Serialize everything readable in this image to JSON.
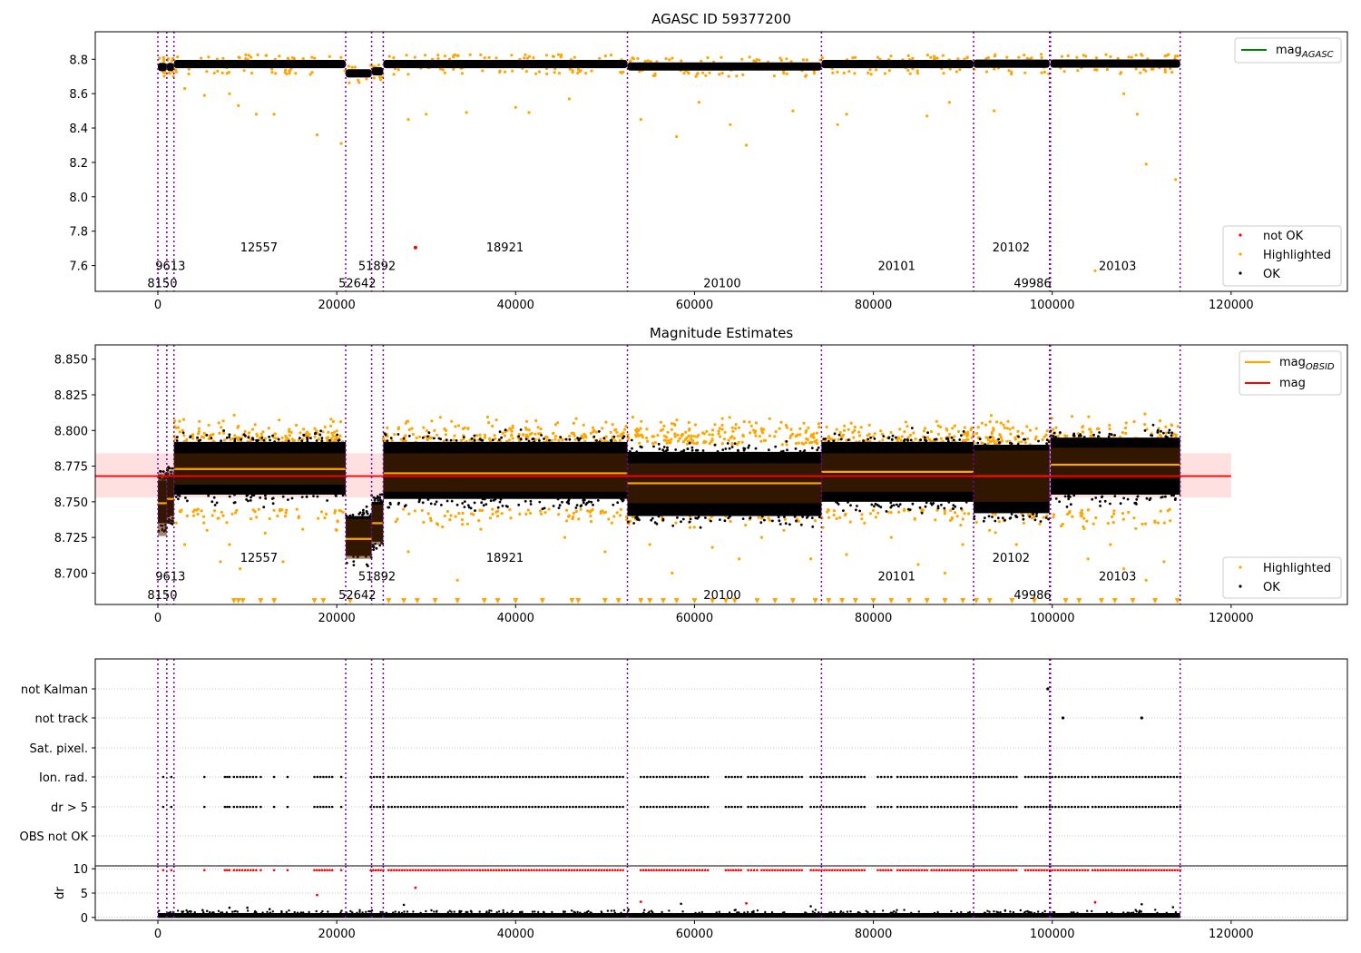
{
  "chart_data": [
    {
      "type": "scatter",
      "title": "AGASC ID 59377200",
      "xlabel": "",
      "ylabel": "",
      "xlim": [
        -7000,
        133000
      ],
      "ylim": [
        7.45,
        8.96
      ],
      "xticks": [
        0,
        20000,
        40000,
        60000,
        80000,
        100000,
        120000
      ],
      "xtick_labels": [
        "0",
        "20000",
        "40000",
        "60000",
        "80000",
        "100000",
        "120000"
      ],
      "yticks": [
        7.6,
        7.8,
        8.0,
        8.2,
        8.4,
        8.6,
        8.8
      ],
      "ytick_labels": [
        "7.6",
        "7.8",
        "8.0",
        "8.2",
        "8.4",
        "8.6",
        "8.8"
      ],
      "obsid_boundaries": [
        0,
        1000,
        1800,
        21000,
        23900,
        25200,
        52500,
        74200,
        91200,
        99700,
        99800,
        114300
      ],
      "obsid_labels": [
        {
          "text": "8150",
          "x": 500,
          "y": 7.5
        },
        {
          "text": "9613",
          "x": 1400,
          "y": 7.6
        },
        {
          "text": "12557",
          "x": 11300,
          "y": 7.71
        },
        {
          "text": "52642",
          "x": 22300,
          "y": 7.5
        },
        {
          "text": "51892",
          "x": 24500,
          "y": 7.6
        },
        {
          "text": "18921",
          "x": 38800,
          "y": 7.71
        },
        {
          "text": "20100",
          "x": 63100,
          "y": 7.5
        },
        {
          "text": "20101",
          "x": 82600,
          "y": 7.6
        },
        {
          "text": "20102",
          "x": 95400,
          "y": 7.71
        },
        {
          "text": "49986",
          "x": 97800,
          "y": 7.5
        },
        {
          "text": "20103",
          "x": 107300,
          "y": 7.6
        }
      ],
      "segments": [
        {
          "x0": 0,
          "x1": 1000,
          "mag": 8.755
        },
        {
          "x0": 1000,
          "x1": 1800,
          "mag": 8.755
        },
        {
          "x0": 1800,
          "x1": 21000,
          "mag": 8.772
        },
        {
          "x0": 21000,
          "x1": 23900,
          "mag": 8.718
        },
        {
          "x0": 23900,
          "x1": 25200,
          "mag": 8.73
        },
        {
          "x0": 25200,
          "x1": 52500,
          "mag": 8.772
        },
        {
          "x0": 52500,
          "x1": 74200,
          "mag": 8.758
        },
        {
          "x0": 74200,
          "x1": 91200,
          "mag": 8.772
        },
        {
          "x0": 91200,
          "x1": 99700,
          "mag": 8.774
        },
        {
          "x0": 99800,
          "x1": 114300,
          "mag": 8.775
        }
      ],
      "series": [
        {
          "name": "not OK",
          "color": "#ff0000",
          "points": [
            [
              28800,
              7.705
            ]
          ]
        },
        {
          "name": "Highlighted",
          "color": "#ffa500",
          "points": [
            [
              3000,
              8.63
            ],
            [
              5200,
              8.59
            ],
            [
              8000,
              8.6
            ],
            [
              9000,
              8.53
            ],
            [
              11000,
              8.48
            ],
            [
              13000,
              8.48
            ],
            [
              17800,
              8.36
            ],
            [
              20500,
              8.31
            ],
            [
              28000,
              8.45
            ],
            [
              30000,
              8.48
            ],
            [
              34500,
              8.49
            ],
            [
              40000,
              8.52
            ],
            [
              41500,
              8.49
            ],
            [
              46000,
              8.57
            ],
            [
              54000,
              8.45
            ],
            [
              58000,
              8.35
            ],
            [
              60500,
              8.55
            ],
            [
              64000,
              8.42
            ],
            [
              65800,
              8.3
            ],
            [
              71000,
              8.5
            ],
            [
              76000,
              8.42
            ],
            [
              77000,
              8.48
            ],
            [
              86000,
              8.47
            ],
            [
              88500,
              8.55
            ],
            [
              93500,
              8.5
            ],
            [
              104800,
              7.57
            ],
            [
              108000,
              8.6
            ],
            [
              109500,
              8.48
            ],
            [
              110500,
              8.19
            ],
            [
              113800,
              8.1
            ]
          ]
        },
        {
          "name": "OK",
          "color": "#000000"
        }
      ],
      "legend_line": {
        "name": "mag",
        "sub": "AGASC",
        "color": "#008000"
      },
      "legend_points_placement": "lower-right",
      "legend_line_placement": "upper-right"
    },
    {
      "type": "scatter",
      "title": "Magnitude Estimates",
      "xlabel": "",
      "ylabel": "",
      "xlim": [
        -7000,
        133000
      ],
      "ylim": [
        8.678,
        8.86
      ],
      "xticks": [
        0,
        20000,
        40000,
        60000,
        80000,
        100000,
        120000
      ],
      "xtick_labels": [
        "0",
        "20000",
        "40000",
        "60000",
        "80000",
        "100000",
        "120000"
      ],
      "yticks": [
        8.7,
        8.725,
        8.75,
        8.775,
        8.8,
        8.825,
        8.85
      ],
      "ytick_labels": [
        "8.700",
        "8.725",
        "8.750",
        "8.775",
        "8.800",
        "8.825",
        "8.850"
      ],
      "obsid_labels": [
        {
          "text": "8150",
          "x": 500,
          "y": 8.685
        },
        {
          "text": "9613",
          "x": 1400,
          "y": 8.698
        },
        {
          "text": "12557",
          "x": 11300,
          "y": 8.711
        },
        {
          "text": "52642",
          "x": 22300,
          "y": 8.685
        },
        {
          "text": "51892",
          "x": 24500,
          "y": 8.698
        },
        {
          "text": "18921",
          "x": 38800,
          "y": 8.711
        },
        {
          "text": "20100",
          "x": 63100,
          "y": 8.685
        },
        {
          "text": "20101",
          "x": 82600,
          "y": 8.698
        },
        {
          "text": "20102",
          "x": 95400,
          "y": 8.711
        },
        {
          "text": "49986",
          "x": 97800,
          "y": 8.685
        },
        {
          "text": "20103",
          "x": 107300,
          "y": 8.698
        }
      ],
      "mag": 8.768,
      "mag_band": [
        8.753,
        8.784
      ],
      "mag_line_x": [
        -7000,
        120000
      ],
      "segments": [
        {
          "x0": 0,
          "x1": 1000,
          "mag": 8.749,
          "band": [
            8.726,
            8.77
          ],
          "bulk": [
            8.735,
            8.765
          ]
        },
        {
          "x0": 1000,
          "x1": 1800,
          "mag": 8.752,
          "band": [
            8.735,
            8.772
          ],
          "bulk": [
            8.74,
            8.768
          ]
        },
        {
          "x0": 1800,
          "x1": 21000,
          "mag": 8.773,
          "band": [
            8.762,
            8.784
          ],
          "bulk": [
            8.755,
            8.792
          ]
        },
        {
          "x0": 21000,
          "x1": 23900,
          "mag": 8.724,
          "band": [
            8.71,
            8.738
          ],
          "bulk": [
            8.712,
            8.74
          ]
        },
        {
          "x0": 23900,
          "x1": 25200,
          "mag": 8.735,
          "band": [
            8.72,
            8.748
          ],
          "bulk": [
            8.722,
            8.75
          ]
        },
        {
          "x0": 25200,
          "x1": 52500,
          "mag": 8.77,
          "band": [
            8.757,
            8.784
          ],
          "bulk": [
            8.752,
            8.792
          ]
        },
        {
          "x0": 52500,
          "x1": 74200,
          "mag": 8.763,
          "band": [
            8.749,
            8.777
          ],
          "bulk": [
            8.74,
            8.785
          ]
        },
        {
          "x0": 74200,
          "x1": 91200,
          "mag": 8.771,
          "band": [
            8.757,
            8.784
          ],
          "bulk": [
            8.75,
            8.792
          ]
        },
        {
          "x0": 91200,
          "x1": 99700,
          "mag": 8.768,
          "band": [
            8.75,
            8.786
          ],
          "bulk": [
            8.742,
            8.79
          ]
        },
        {
          "x0": 99800,
          "x1": 114300,
          "mag": 8.776,
          "band": [
            8.766,
            8.788
          ],
          "bulk": [
            8.755,
            8.795
          ]
        }
      ],
      "highlight_bands": [
        {
          "x0": 1800,
          "x1": 21000,
          "top": 8.825
        },
        {
          "x0": 25200,
          "x1": 52500,
          "top": 8.82
        },
        {
          "x0": 52500,
          "x1": 74200,
          "top": 8.815
        },
        {
          "x0": 74200,
          "x1": 91200,
          "top": 8.815
        },
        {
          "x0": 91200,
          "x1": 99700,
          "top": 8.815
        },
        {
          "x0": 99800,
          "x1": 114300,
          "top": 8.82
        }
      ],
      "outliers_low": [
        [
          3000,
          8.72
        ],
        [
          5500,
          8.73
        ],
        [
          7000,
          8.708
        ],
        [
          8000,
          8.72
        ],
        [
          9200,
          8.703
        ],
        [
          12000,
          8.728
        ],
        [
          14000,
          8.708
        ],
        [
          20000,
          8.73
        ],
        [
          28000,
          8.715
        ],
        [
          33500,
          8.695
        ],
        [
          38000,
          8.74
        ],
        [
          45500,
          8.725
        ],
        [
          50000,
          8.715
        ],
        [
          55000,
          8.72
        ],
        [
          57500,
          8.7
        ],
        [
          59500,
          8.732
        ],
        [
          62000,
          8.718
        ],
        [
          65000,
          8.71
        ],
        [
          67500,
          8.725
        ],
        [
          70000,
          8.73
        ],
        [
          73000,
          8.71
        ],
        [
          77000,
          8.713
        ],
        [
          82000,
          8.725
        ],
        [
          85000,
          8.706
        ],
        [
          88000,
          8.7
        ],
        [
          90000,
          8.72
        ],
        [
          93000,
          8.73
        ],
        [
          96000,
          8.72
        ],
        [
          101000,
          8.733
        ],
        [
          104000,
          8.71
        ],
        [
          106500,
          8.72
        ],
        [
          108000,
          8.703
        ],
        [
          110500,
          8.695
        ],
        [
          112500,
          8.708
        ]
      ],
      "clipped_markers_x": [
        8500,
        9000,
        9500,
        11500,
        13000,
        17500,
        18500,
        21500,
        25800,
        27500,
        29000,
        31000,
        33500,
        36500,
        38000,
        40000,
        43000,
        46300,
        47000,
        50000,
        51500,
        54000,
        55000,
        56500,
        58000,
        60000,
        62000,
        63500,
        64500,
        67000,
        69000,
        71000,
        73500,
        75000,
        76500,
        78000,
        80000,
        82000,
        84000,
        86000,
        88000,
        90000,
        91500,
        93000,
        95500,
        98000,
        101500,
        103000,
        105500,
        107000,
        109000,
        111500,
        114000
      ],
      "legend_points_placement": "lower-right",
      "legend_lines": [
        {
          "name": "mag",
          "sub": "OBSID",
          "color": "#ffa500"
        },
        {
          "name": "mag",
          "sub": "",
          "color": "#ff0000"
        }
      ],
      "legend_line_placement": "upper-right"
    },
    {
      "type": "scatter",
      "title": "",
      "xlabel": "",
      "ylabel": "",
      "xlim": [
        -7000,
        133000
      ],
      "categories": [
        "not Kalman",
        "not track",
        "Sat. pixel.",
        "Ion. rad.",
        "dr > 5",
        "OBS not OK"
      ],
      "flag_points": {
        "not Kalman": [
          99500
        ],
        "not track": [
          101200,
          110000
        ],
        "Sat. pixel.": [],
        "Ion. rad.": [
          [
            600,
            0
          ],
          [
            1500,
            0
          ],
          [
            5200,
            0
          ],
          [
            7500,
            8000
          ],
          [
            8500,
            11000
          ],
          [
            11500,
            0
          ],
          [
            13000,
            0
          ],
          [
            14500,
            0
          ],
          [
            17500,
            19500
          ],
          [
            20500,
            0
          ],
          [
            23800,
            25200
          ],
          [
            25800,
            52000
          ],
          [
            54000,
            57200
          ],
          [
            57500,
            61500
          ],
          [
            63500,
            65200
          ],
          [
            66000,
            67000
          ],
          [
            67500,
            72000
          ],
          [
            73000,
            79000
          ],
          [
            80500,
            82000
          ],
          [
            82700,
            86000
          ],
          [
            86500,
            91200
          ],
          [
            91500,
            96000
          ],
          [
            97000,
            99700
          ],
          [
            100000,
            104000
          ],
          [
            104500,
            114300
          ]
        ],
        "dr > 5": [
          [
            600,
            0
          ],
          [
            1500,
            0
          ],
          [
            5200,
            0
          ],
          [
            7500,
            8000
          ],
          [
            8500,
            11000
          ],
          [
            11500,
            0
          ],
          [
            13000,
            0
          ],
          [
            14500,
            0
          ],
          [
            17500,
            19500
          ],
          [
            20500,
            0
          ],
          [
            23800,
            25200
          ],
          [
            25800,
            52000
          ],
          [
            54000,
            57200
          ],
          [
            57500,
            61500
          ],
          [
            63500,
            65200
          ],
          [
            66000,
            67000
          ],
          [
            67500,
            72000
          ],
          [
            73000,
            79000
          ],
          [
            80500,
            82000
          ],
          [
            82700,
            86000
          ],
          [
            86500,
            91200
          ],
          [
            91500,
            96000
          ],
          [
            97000,
            99700
          ],
          [
            100000,
            104000
          ],
          [
            104500,
            114300
          ]
        ],
        "OBS not OK": []
      }
    },
    {
      "type": "scatter",
      "title": "",
      "xlabel": "",
      "ylabel": "dr",
      "xlim": [
        -7000,
        133000
      ],
      "ylim": [
        -0.6,
        10.6
      ],
      "xticks": [
        0,
        20000,
        40000,
        60000,
        80000,
        100000,
        120000
      ],
      "xtick_labels": [
        "0",
        "20000",
        "40000",
        "60000",
        "80000",
        "100000",
        "120000"
      ],
      "yticks": [
        0,
        5,
        10
      ],
      "ytick_labels": [
        "0",
        "5",
        "10"
      ],
      "series": [
        {
          "name": "dr",
          "color": "#000000"
        },
        {
          "name": "dr > 5",
          "color": "#ff0000",
          "points": [
            [
              17800,
              4.6
            ],
            [
              28800,
              6.1
            ],
            [
              54000,
              3.2
            ],
            [
              65800,
              2.9
            ],
            [
              104800,
              3.1
            ]
          ]
        }
      ],
      "scattered_low_black": [
        [
          5000,
          1.5
        ],
        [
          8000,
          2.0
        ],
        [
          10000,
          2.0
        ],
        [
          12500,
          1.7
        ],
        [
          27500,
          2.6
        ],
        [
          35000,
          1.3
        ],
        [
          58500,
          2.8
        ],
        [
          64500,
          1.5
        ],
        [
          73000,
          2.3
        ],
        [
          110000,
          2.7
        ],
        [
          113500,
          2.1
        ]
      ]
    }
  ]
}
